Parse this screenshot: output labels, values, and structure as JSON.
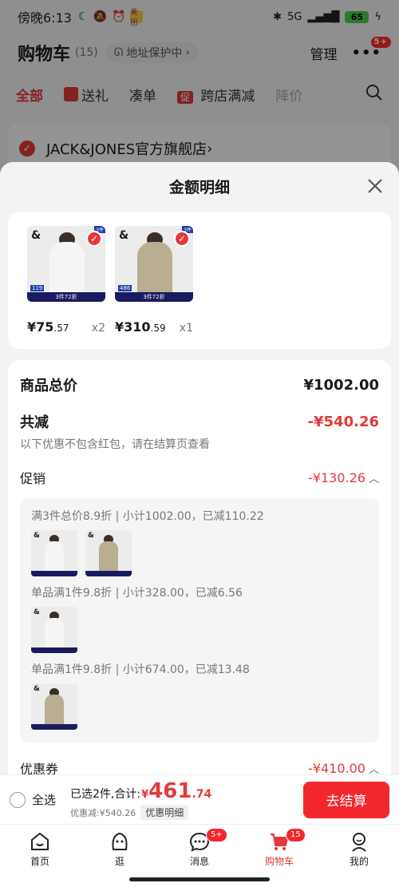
{
  "status_bar": {
    "time": "傍晚6:13",
    "app_badge": "美团",
    "network": "5G",
    "battery": "65"
  },
  "cart_header": {
    "title": "购物车",
    "count": "(15)",
    "address_protect": "地址保护中",
    "manage": "管理",
    "more_badge": "5+"
  },
  "filter_tabs": {
    "all": "全部",
    "gift": "送礼",
    "bundle": "凑单",
    "promo_tag": "促",
    "cross_store": "跨店满减",
    "price_drop": "降价"
  },
  "store": {
    "name": "JACK&JONES官方旗舰店"
  },
  "sheet": {
    "title": "金额明细",
    "products": [
      {
        "price_int": "¥75",
        "price_dec": ".57",
        "qty": "x2",
        "tag": "3件72折",
        "price_label": "119",
        "fig_color": "#f5f5f5"
      },
      {
        "price_int": "¥310",
        "price_dec": ".59",
        "qty": "x1",
        "tag": "3件72折",
        "price_label": "486",
        "fig_color": "#b9ad92"
      }
    ],
    "total_label": "商品总价",
    "total_value": "¥1002.00",
    "reduce_label": "共减",
    "reduce_value": "-¥540.26",
    "reduce_note": "以下优惠不包含红包，请在结算页查看",
    "promo_label": "促销",
    "promo_value": "-¥130.26",
    "promo_lines": [
      "满3件总价8.9折 | 小计1002.00，已减110.22",
      "单品满1件9.8折 | 小计328.00，已减6.56",
      "单品满1件9.8折 | 小计674.00，已减13.48"
    ],
    "coupon_label": "优惠券",
    "coupon_value": "-¥410.00"
  },
  "checkout": {
    "select_all": "全选",
    "selected_prefix": "已选2件,合计:",
    "currency": "¥",
    "total_int": "461",
    "total_dec": ".74",
    "discount_text": "优惠减:¥540.26",
    "detail_pill": "优惠明细",
    "pay_button": "去结算"
  },
  "tabbar": {
    "home": "首页",
    "browse": "逛",
    "messages": "消息",
    "messages_badge": "5+",
    "cart": "购物车",
    "cart_badge": "15",
    "mine": "我的"
  },
  "colors": {
    "accent": "#e4393c",
    "pay_button": "#f2272d"
  }
}
